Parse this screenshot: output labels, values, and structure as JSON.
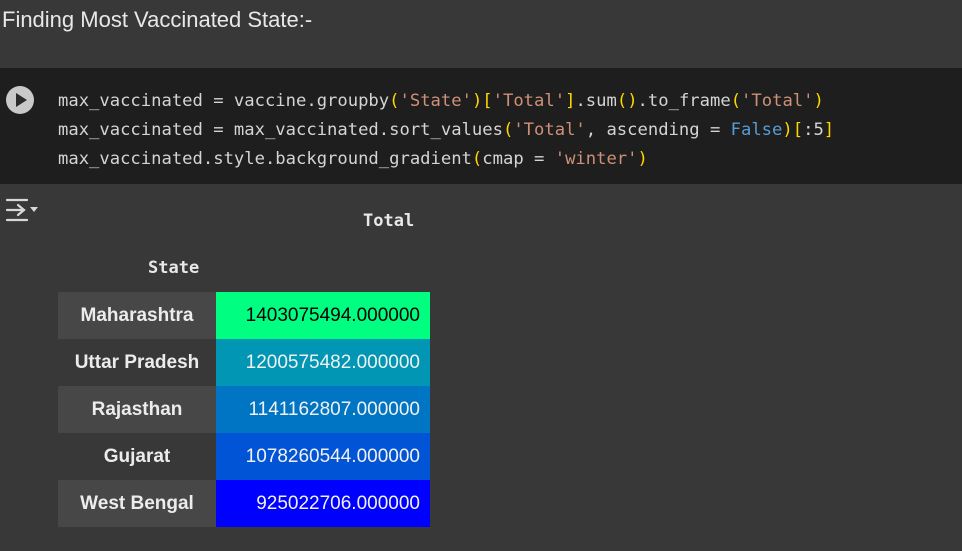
{
  "text_cell": {
    "heading": "Finding Most Vaccinated State:-"
  },
  "code_cell": {
    "run_icon": "play-icon",
    "lines": [
      "max_vaccinated = vaccine.groupby('State')['Total'].sum().to_frame('Total')",
      "max_vaccinated = max_vaccinated.sort_values('Total', ascending = False)[:5]",
      "max_vaccinated.style.background_gradient(cmap = 'winter')"
    ]
  },
  "output": {
    "icon": "output-options-icon",
    "column_header": "Total",
    "index_name": "State",
    "rows": [
      {
        "state": "Maharashtra",
        "total": "1403075494.000000",
        "bg": "#00ff80",
        "fg": "#000000"
      },
      {
        "state": "Uttar Pradesh",
        "total": "1200575482.000000",
        "bg": "#0096b4",
        "fg": "#f1f1f1"
      },
      {
        "state": "Rajasthan",
        "total": "1141162807.000000",
        "bg": "#0075c4",
        "fg": "#f1f1f1"
      },
      {
        "state": "Gujarat",
        "total": "1078260544.000000",
        "bg": "#0054d5",
        "fg": "#f1f1f1"
      },
      {
        "state": "West Bengal",
        "total": "925022706.000000",
        "bg": "#0000ff",
        "fg": "#f1f1f1"
      }
    ]
  }
}
